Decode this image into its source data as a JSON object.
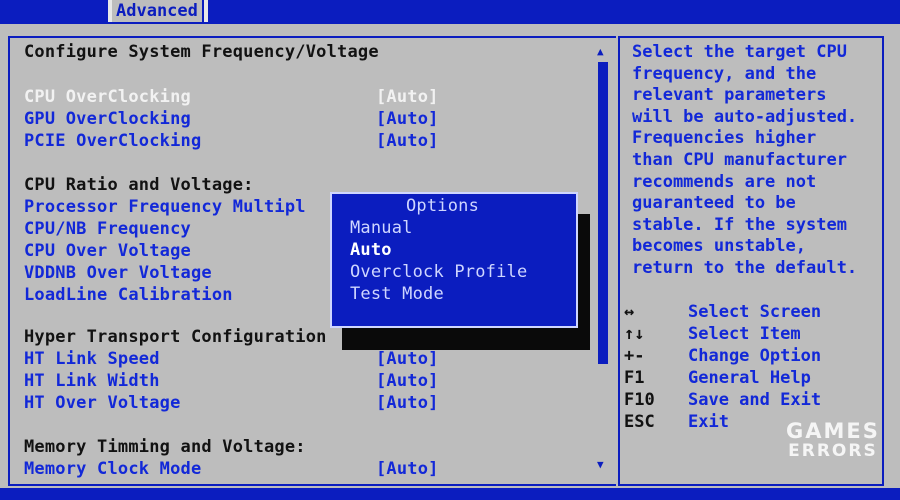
{
  "header": {
    "active_tab": "Advanced"
  },
  "main": {
    "title": "Configure System Frequency/Voltage",
    "overclock_items": [
      {
        "label": "CPU OverClocking",
        "value": "[Auto]"
      },
      {
        "label": "GPU OverClocking",
        "value": "[Auto]"
      },
      {
        "label": "PCIE OverClocking",
        "value": "[Auto]"
      }
    ],
    "cpu_section": {
      "heading": "CPU Ratio and Voltage:",
      "items": [
        "Processor Frequency Multipl",
        "CPU/NB Frequency",
        "CPU Over Voltage",
        "VDDNB Over Voltage",
        "LoadLine Calibration"
      ]
    },
    "ht_section": {
      "heading": "Hyper Transport Configuration",
      "items": [
        {
          "label": "HT Link Speed",
          "value": "[Auto]"
        },
        {
          "label": "HT Link Width",
          "value": "[Auto]"
        },
        {
          "label": "HT Over Voltage",
          "value": "[Auto]"
        }
      ]
    },
    "memory_section": {
      "heading": "Memory Timming and Voltage:",
      "items": [
        {
          "label": "Memory Clock Mode",
          "value": "[Auto]"
        }
      ]
    }
  },
  "popup": {
    "title": "Options",
    "options": [
      "Manual",
      "Auto",
      "Overclock Profile",
      "Test Mode"
    ],
    "selected": "Auto"
  },
  "help": {
    "lines": [
      "Select the target CPU",
      "frequency, and the",
      "relevant parameters",
      "will be auto-adjusted.",
      "Frequencies higher",
      "than CPU manufacturer",
      "recommends are not",
      "guaranteed to be",
      "stable. If the system",
      "becomes unstable,",
      "return to the default."
    ],
    "keys": [
      {
        "key": "↔",
        "desc": "Select Screen"
      },
      {
        "key": "↑↓",
        "desc": "Select Item"
      },
      {
        "key": "+-",
        "desc": "Change Option"
      },
      {
        "key": "F1",
        "desc": "General Help"
      },
      {
        "key": "F10",
        "desc": "Save and Exit"
      },
      {
        "key": "ESC",
        "desc": "Exit"
      }
    ]
  },
  "watermark": {
    "line1": "GAMES",
    "line2": "ERRORS"
  },
  "colors": {
    "bios_blue": "#0b1dbf",
    "background_gray": "#bdbdbd",
    "text_blue": "#1228d8",
    "highlight_white": "#f2f2f2"
  }
}
